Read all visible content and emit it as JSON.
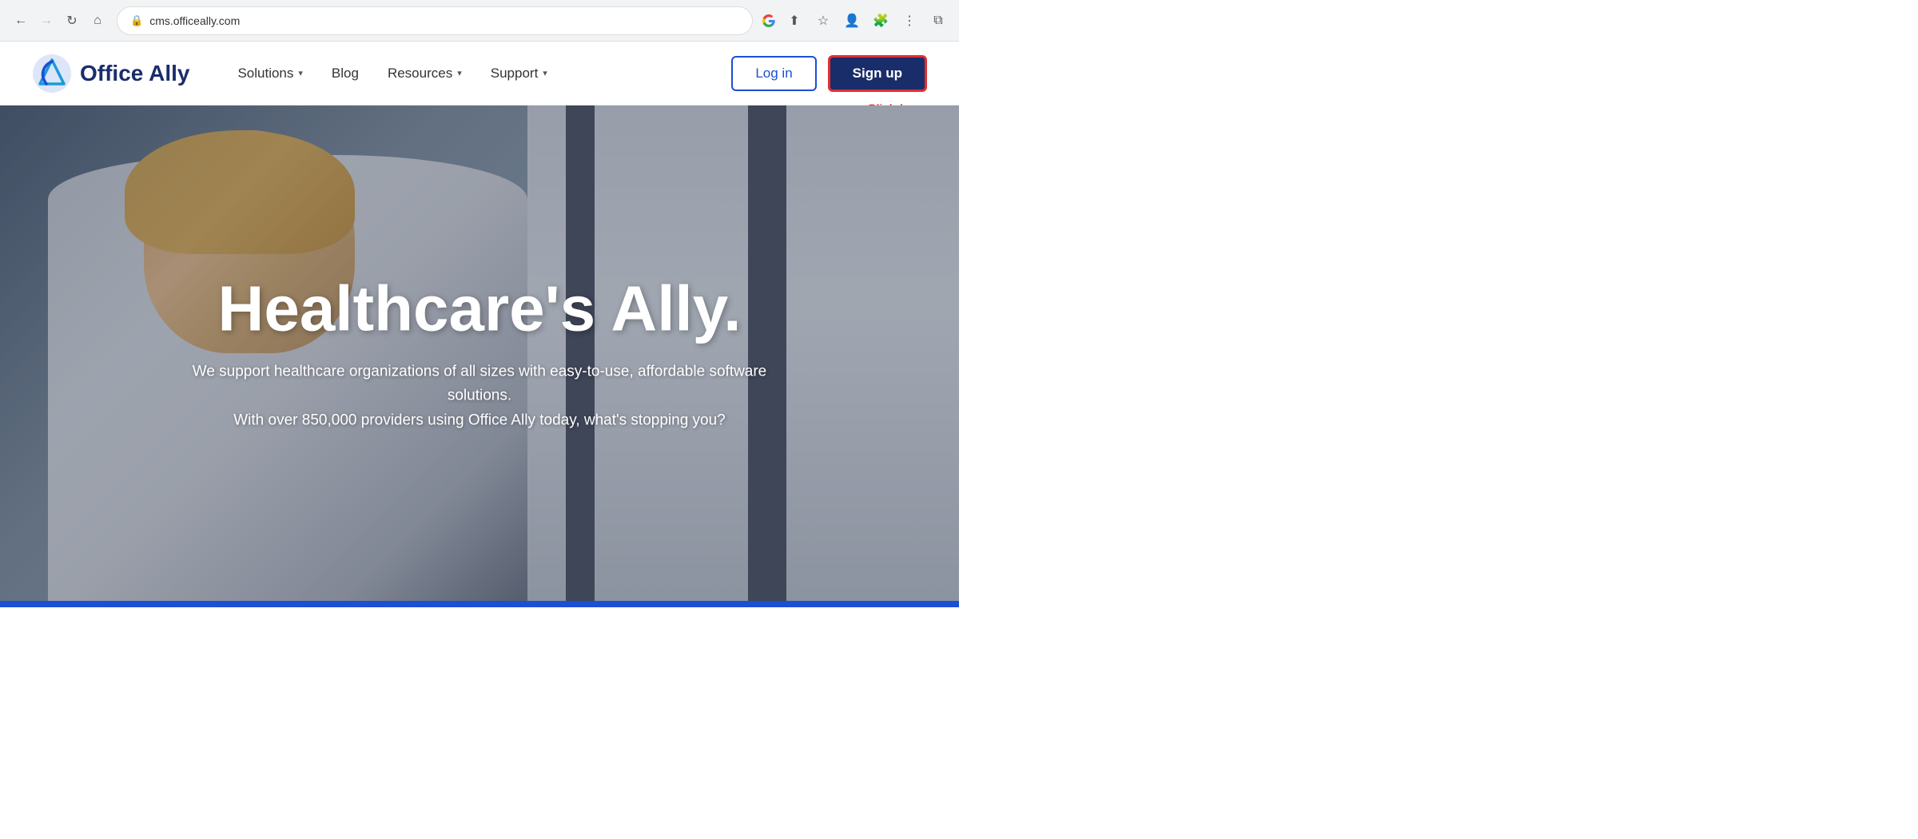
{
  "browser": {
    "url": "cms.officeally.com",
    "back_disabled": false,
    "forward_disabled": false
  },
  "header": {
    "logo_text": "Office Ally",
    "nav_items": [
      {
        "label": "Solutions",
        "has_dropdown": true
      },
      {
        "label": "Blog",
        "has_dropdown": false
      },
      {
        "label": "Resources",
        "has_dropdown": true
      },
      {
        "label": "Support",
        "has_dropdown": true
      }
    ],
    "login_label": "Log in",
    "signup_label": "Sign up",
    "click_here_label": "Click here"
  },
  "hero": {
    "title": "Healthcare's Ally.",
    "subtitle": "We support healthcare organizations of all sizes with easy-to-use, affordable software solutions.\nWith over 850,000 providers using Office Ally today, what's stopping you?"
  }
}
